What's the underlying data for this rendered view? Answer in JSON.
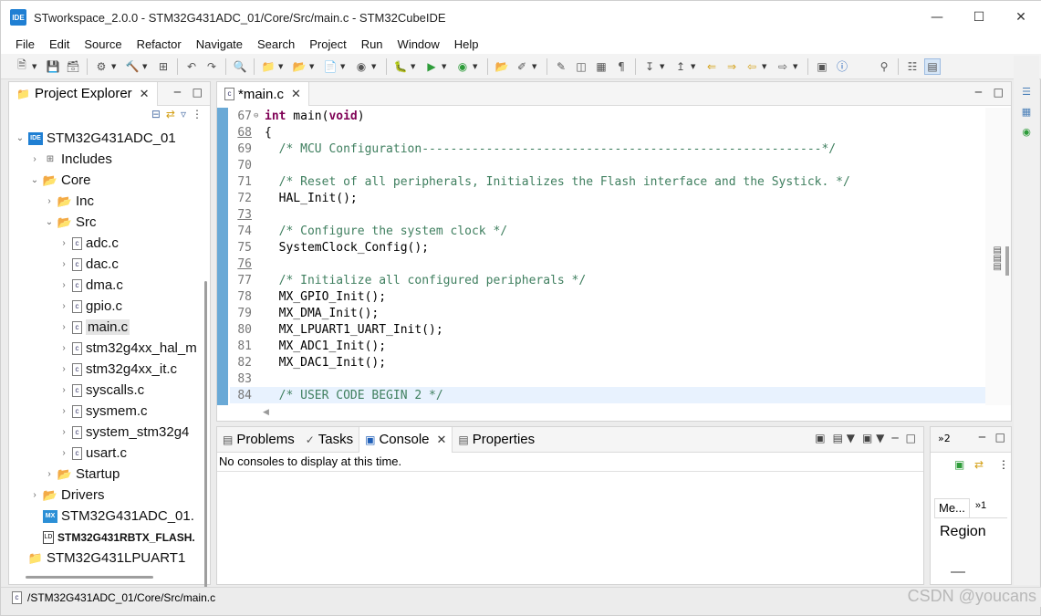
{
  "window": {
    "title": "STworkspace_2.0.0 - STM32G431ADC_01/Core/Src/main.c - STM32CubeIDE",
    "app_icon_text": "IDE"
  },
  "menu": [
    "File",
    "Edit",
    "Source",
    "Refactor",
    "Navigate",
    "Search",
    "Project",
    "Run",
    "Window",
    "Help"
  ],
  "project_explorer": {
    "tab_label": "Project Explorer",
    "tree": [
      {
        "label": "STM32G431ADC_01",
        "level": 0,
        "twist": "v",
        "icon": "ide"
      },
      {
        "label": "Includes",
        "level": 1,
        "twist": ">",
        "icon": "includes"
      },
      {
        "label": "Core",
        "level": 1,
        "twist": "v",
        "icon": "folder"
      },
      {
        "label": "Inc",
        "level": 2,
        "twist": ">",
        "icon": "folder"
      },
      {
        "label": "Src",
        "level": 2,
        "twist": "v",
        "icon": "folder"
      },
      {
        "label": "adc.c",
        "level": 3,
        "twist": ">",
        "icon": "c"
      },
      {
        "label": "dac.c",
        "level": 3,
        "twist": ">",
        "icon": "c"
      },
      {
        "label": "dma.c",
        "level": 3,
        "twist": ">",
        "icon": "c"
      },
      {
        "label": "gpio.c",
        "level": 3,
        "twist": ">",
        "icon": "c"
      },
      {
        "label": "main.c",
        "level": 3,
        "twist": ">",
        "icon": "c",
        "selected": true
      },
      {
        "label": "stm32g4xx_hal_m",
        "level": 3,
        "twist": ">",
        "icon": "c"
      },
      {
        "label": "stm32g4xx_it.c",
        "level": 3,
        "twist": ">",
        "icon": "c"
      },
      {
        "label": "syscalls.c",
        "level": 3,
        "twist": ">",
        "icon": "c"
      },
      {
        "label": "sysmem.c",
        "level": 3,
        "twist": ">",
        "icon": "c"
      },
      {
        "label": "system_stm32g4",
        "level": 3,
        "twist": ">",
        "icon": "c"
      },
      {
        "label": "usart.c",
        "level": 3,
        "twist": ">",
        "icon": "c"
      },
      {
        "label": "Startup",
        "level": 2,
        "twist": ">",
        "icon": "folder"
      },
      {
        "label": "Drivers",
        "level": 1,
        "twist": ">",
        "icon": "folder"
      },
      {
        "label": "STM32G431ADC_01.",
        "level": 1,
        "twist": "",
        "icon": "mx"
      },
      {
        "label": "STM32G431RBTX_FLASH.",
        "level": 1,
        "twist": "",
        "icon": "ld",
        "bold": true
      },
      {
        "label": "STM32G431LPUART1",
        "level": 0,
        "twist": "",
        "icon": "project"
      }
    ]
  },
  "editor": {
    "tab_label": "*main.c",
    "lines": [
      {
        "n": "67",
        "fold": "⊖",
        "html": "<span class=\"kw\">int</span> main(<span class=\"kw\">void</span>)"
      },
      {
        "n": "68",
        "fold": "",
        "html": "{",
        "under": true
      },
      {
        "n": "69",
        "fold": "",
        "html": "  <span class=\"cm\">/* MCU Configuration--------------------------------------------------------*/</span>"
      },
      {
        "n": "70",
        "fold": "",
        "html": ""
      },
      {
        "n": "71",
        "fold": "",
        "html": "  <span class=\"cm\">/* Reset of all peripherals, Initializes the Flash interface and the Systick. */</span>"
      },
      {
        "n": "72",
        "fold": "",
        "html": "  HAL_Init();"
      },
      {
        "n": "73",
        "fold": "",
        "html": "",
        "under": true
      },
      {
        "n": "74",
        "fold": "",
        "html": "  <span class=\"cm\">/* Configure the system clock */</span>"
      },
      {
        "n": "75",
        "fold": "",
        "html": "  SystemClock_Config();"
      },
      {
        "n": "76",
        "fold": "",
        "html": "",
        "under": true
      },
      {
        "n": "77",
        "fold": "",
        "html": "  <span class=\"cm\">/* Initialize all configured peripherals */</span>"
      },
      {
        "n": "78",
        "fold": "",
        "html": "  MX_GPIO_Init();"
      },
      {
        "n": "79",
        "fold": "",
        "html": "  MX_DMA_Init();"
      },
      {
        "n": "80",
        "fold": "",
        "html": "  MX_LPUART1_UART_Init();"
      },
      {
        "n": "81",
        "fold": "",
        "html": "  MX_ADC1_Init();"
      },
      {
        "n": "82",
        "fold": "",
        "html": "  MX_DAC1_Init();"
      },
      {
        "n": "83",
        "fold": "",
        "html": ""
      },
      {
        "n": "84",
        "fold": "",
        "html": "  <span class=\"cm\">/* USER CODE BEGIN 2 */</span>",
        "highlight": true
      }
    ]
  },
  "bottom": {
    "tabs": [
      {
        "label": "Problems",
        "icon": "problems-icon"
      },
      {
        "label": "Tasks",
        "icon": "tasks-icon"
      },
      {
        "label": "Console",
        "icon": "console-icon",
        "active": true
      },
      {
        "label": "Properties",
        "icon": "properties-icon"
      }
    ],
    "console_message": "No consoles to display at this time."
  },
  "memory_panel": {
    "tab_label": "Me...",
    "overflow_label": "»1",
    "top_overflow_label": "»2",
    "region_label": "Region"
  },
  "statusbar": {
    "path": "/STM32G431ADC_01/Core/Src/main.c"
  },
  "watermark": "CSDN @youcans"
}
